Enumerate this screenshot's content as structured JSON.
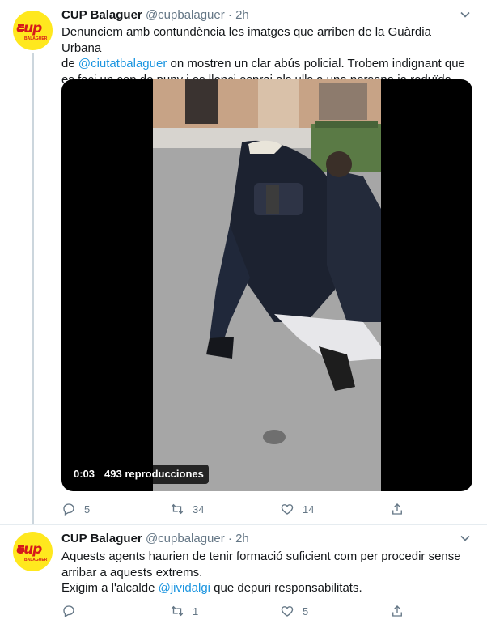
{
  "tweets": [
    {
      "name": "CUP Balaguer",
      "handle": "@cupbalaguer",
      "separator": "·",
      "time": "2h",
      "avatar": {
        "logo": "cup",
        "sub": "BALAGUER",
        "color_bg": "#ffe81e",
        "color_fg": "#d61b1b"
      },
      "text": {
        "line1": "Denunciem amb contundència les imatges que arriben de la Guàrdia Urbana",
        "line2_before": "de ",
        "line2_mention": "@ciutatbalaguer",
        "line2_after": " on mostren un clar abús policial. Trobem indignant que",
        "line3": "es faci un cop de puny i es llenci esprai als ulls a una persona ja reduïda."
      },
      "video": {
        "elapsed": "0:03",
        "views": "493 reproducciones"
      },
      "actions": {
        "replies": "5",
        "retweets": "34",
        "likes": "14"
      }
    },
    {
      "name": "CUP Balaguer",
      "handle": "@cupbalaguer",
      "separator": "·",
      "time": "2h",
      "avatar": {
        "logo": "cup",
        "sub": "BALAGUER",
        "color_bg": "#ffe81e",
        "color_fg": "#d61b1b"
      },
      "text": {
        "line1": "Aquests agents haurien de tenir formació suficient com per procedir sense",
        "line2": "arribar a aquests extrems.",
        "line3_before": "Exigim a l'alcalde ",
        "line3_mention": "@jividalgi",
        "line3_after": " que depuri responsabilitats."
      },
      "actions": {
        "replies": "",
        "retweets": "1",
        "likes": "5"
      }
    }
  ],
  "colors": {
    "accent": "#1b95e0",
    "muted": "#657786",
    "text": "#14171a"
  },
  "icons": [
    "reply-icon",
    "retweet-icon",
    "like-icon",
    "share-icon",
    "caret-down-icon"
  ]
}
